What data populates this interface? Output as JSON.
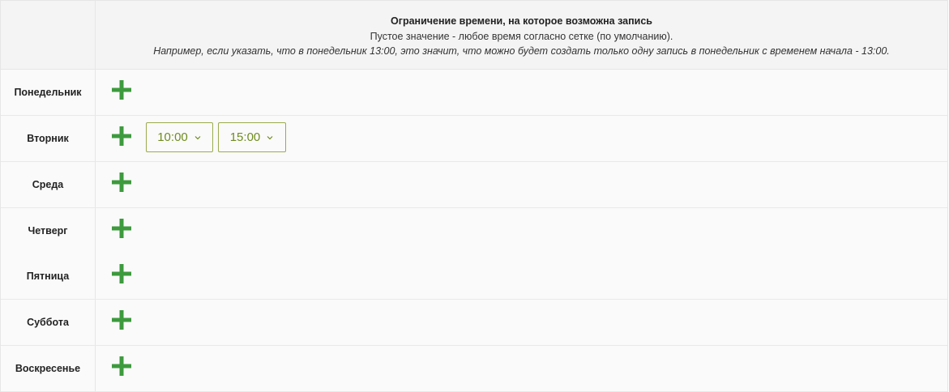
{
  "header": {
    "title": "Ограничение времени, на которое возможна запись",
    "description": "Пустое значение - любое время согласно сетке (по умолчанию).",
    "example": "Например, если указать, что в понедельник 13:00, это значит, что можно будет создать только одну запись в понедельник с временем начала - 13:00."
  },
  "days": [
    {
      "label": "Понедельник",
      "times": []
    },
    {
      "label": "Вторник",
      "times": [
        "10:00",
        "15:00"
      ]
    },
    {
      "label": "Среда",
      "times": []
    },
    {
      "label": "Четверг",
      "times": []
    },
    {
      "label": "Пятница",
      "times": []
    },
    {
      "label": "Суббота",
      "times": []
    },
    {
      "label": "Воскресенье",
      "times": []
    }
  ],
  "icons": {
    "add": "plus-icon",
    "dropdown": "chevron-down-icon"
  },
  "colors": {
    "add_icon": "#3d9a3d",
    "select_border": "#9bab4d",
    "select_text": "#6f8c1e"
  }
}
